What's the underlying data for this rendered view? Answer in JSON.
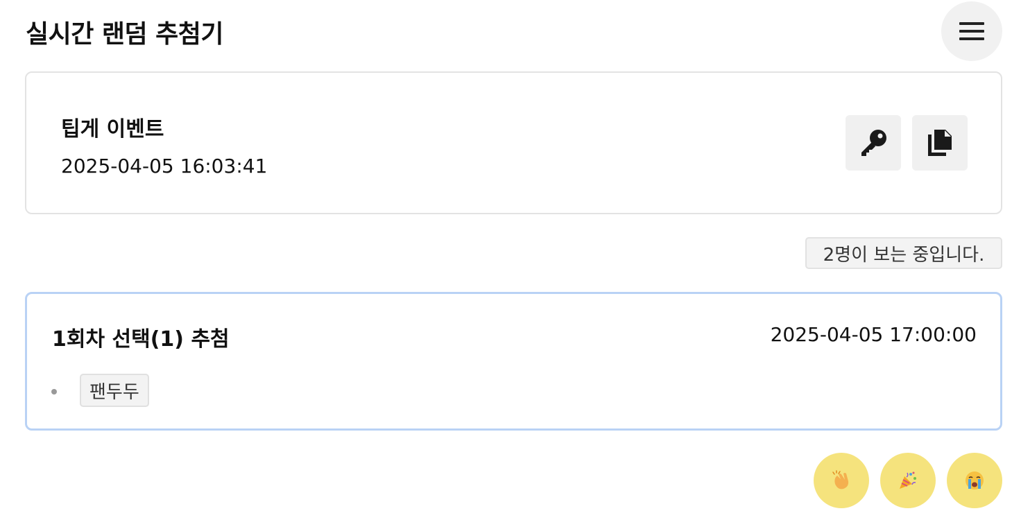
{
  "header": {
    "title": "실시간 랜덤 추첨기",
    "menu_icon": "hamburger-menu-icon"
  },
  "event": {
    "name": "팁게 이벤트",
    "created_at": "2025-04-05 16:03:41",
    "actions": [
      {
        "icon": "key-icon"
      },
      {
        "icon": "copy-icon"
      }
    ]
  },
  "viewers": {
    "text": "2명이 보는 중입니다."
  },
  "rounds": [
    {
      "title": "1회차 선택(1) 추첨",
      "time": "2025-04-05 17:00:00",
      "winners": [
        "팬두두"
      ]
    }
  ],
  "reactions": [
    {
      "icon": "clapping-hands-icon"
    },
    {
      "icon": "party-popper-icon"
    },
    {
      "icon": "crying-face-icon"
    }
  ],
  "colors": {
    "reaction_bg": "#f5e37d",
    "round_border": "#b9d2f5",
    "button_bg": "#f0f0f0"
  }
}
